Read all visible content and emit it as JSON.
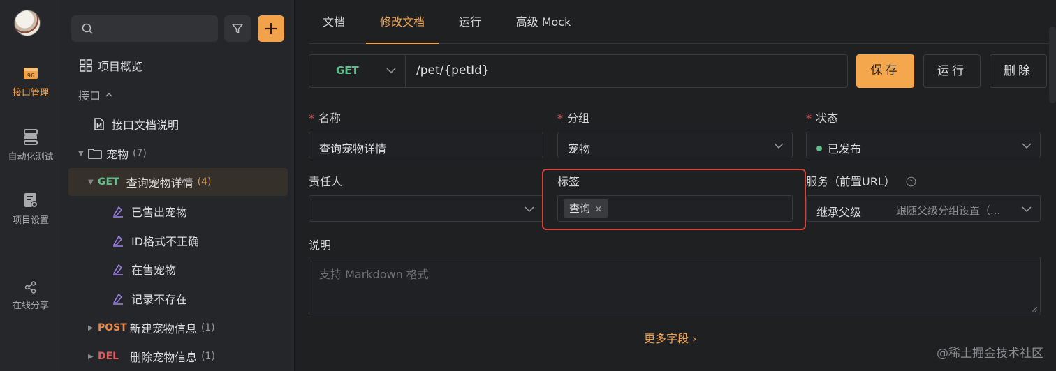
{
  "rail": {
    "items": [
      {
        "label": "接口管理",
        "icon": "api-management-icon"
      },
      {
        "label": "自动化测试",
        "icon": "automation-test-icon"
      },
      {
        "label": "项目设置",
        "icon": "project-settings-icon"
      },
      {
        "label": "在线分享",
        "icon": "share-icon"
      }
    ]
  },
  "sidebar": {
    "overview": "项目概览",
    "api_section": "接口",
    "doc_item": "接口文档说明",
    "folder": {
      "name": "宠物",
      "count": "(7)"
    },
    "selected": {
      "method": "GET",
      "name": "查询宠物详情",
      "count": "(4)"
    },
    "cases": [
      "已售出宠物",
      "ID格式不正确",
      "在售宠物",
      "记录不存在"
    ],
    "post": {
      "method": "POST",
      "name": "新建宠物信息",
      "count": "(1)"
    },
    "del": {
      "method": "DEL",
      "name": "删除宠物信息",
      "count": "(1)"
    }
  },
  "tabs": [
    "文档",
    "修改文档",
    "运行",
    "高级 Mock"
  ],
  "request": {
    "method": "GET",
    "path": "/pet/{petId}"
  },
  "buttons": {
    "save": "保存",
    "run": "运行",
    "delete": "删除"
  },
  "form": {
    "name_label": "名称",
    "name_value": "查询宠物详情",
    "group_label": "分组",
    "group_value": "宠物",
    "status_label": "状态",
    "status_value": "已发布",
    "owner_label": "责任人",
    "tags_label": "标签",
    "tag": "查询",
    "service_label": "服务（前置URL）",
    "service_value": "继承父级",
    "service_hint": "跟随父级分组设置（...",
    "desc_label": "说明",
    "desc_placeholder": "支持 Markdown 格式"
  },
  "more_fields": "更多字段 ›",
  "watermark": "@稀土掘金技术社区",
  "colors": {
    "accent": "#f2a24b",
    "get": "#5fbf8a",
    "post": "#e9894a",
    "del": "#e35a5a",
    "highlight": "#d5443a"
  }
}
